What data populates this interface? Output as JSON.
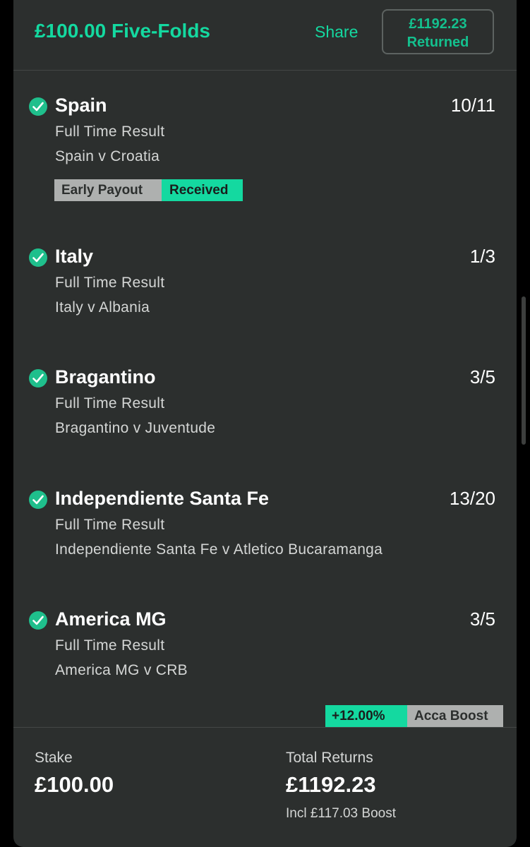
{
  "header": {
    "title": "£100.00 Five-Folds",
    "share_label": "Share",
    "returned_amount": "£1192.23",
    "returned_label": "Returned"
  },
  "legs": [
    {
      "selection": "Spain",
      "odds": "10/11",
      "market": "Full Time Result",
      "event": "Spain v Croatia",
      "badges": [
        "Early Payout",
        "Received"
      ]
    },
    {
      "selection": "Italy",
      "odds": "1/3",
      "market": "Full Time Result",
      "event": "Italy v Albania"
    },
    {
      "selection": "Bragantino",
      "odds": "3/5",
      "market": "Full Time Result",
      "event": "Bragantino v Juventude"
    },
    {
      "selection": "Independiente Santa Fe",
      "odds": "13/20",
      "market": "Full Time Result",
      "event": "Independiente Santa Fe v Atletico Bucaramanga"
    },
    {
      "selection": "America MG",
      "odds": "3/5",
      "market": "Full Time Result",
      "event": "America MG v CRB"
    }
  ],
  "boost": {
    "percent": "+12.00%",
    "label": "Acca Boost"
  },
  "footer": {
    "stake_label": "Stake",
    "stake_value": "£100.00",
    "returns_label": "Total Returns",
    "returns_value": "£1192.23",
    "boost_note": "Incl £117.03 Boost"
  },
  "colors": {
    "accent": "#14d9a0",
    "card_bg": "#2c2f2e",
    "badge_grey": "#aeb0af"
  },
  "icons": {
    "leg_status": "check-circle-icon"
  }
}
